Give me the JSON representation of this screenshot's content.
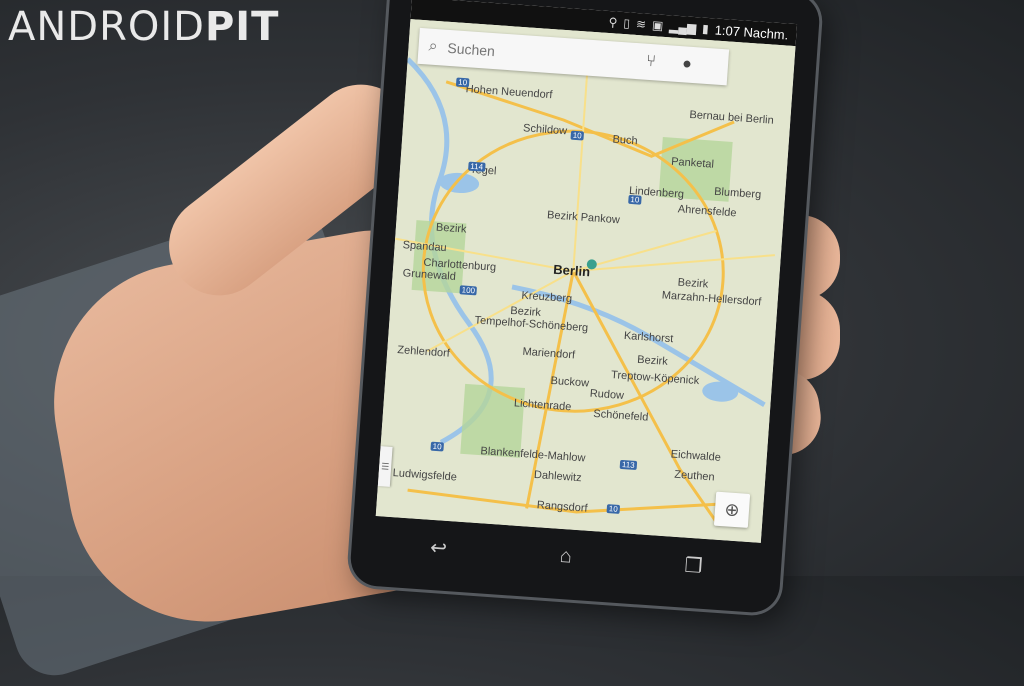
{
  "watermark": {
    "light": "ANDROID",
    "bold": "PIT"
  },
  "statusbar": {
    "time": "1:07 Nachm.",
    "icons": [
      "location-icon",
      "vibrate-icon",
      "wifi-icon",
      "battery-saver-icon",
      "signal-icon",
      "battery-icon"
    ]
  },
  "search": {
    "placeholder": "Suchen",
    "directions_icon": "directions-icon",
    "account_icon": "account-icon"
  },
  "map": {
    "labels": {
      "berlin": "Berlin",
      "pankow": "Bezirk Pankow",
      "marzahn": "Marzahn-Hellersdorf",
      "tempelhof": "Tempelhof-Schöneberg",
      "treptow": "Treptow-Köpenick",
      "kreuzberg": "Kreuzberg",
      "charlottenburg": "Charlottenburg",
      "karlshorst": "Karlshorst",
      "zehlendorf": "Zehlendorf",
      "lichtenrade": "Lichtenrade",
      "blankenfelde": "Blankenfelde-Mahlow",
      "bezirk1": "Bezirk",
      "bezirk2": "Bezirk",
      "bezirk3": "Bezirk",
      "bezirk4": "Bezirk",
      "spandau": "Spandau",
      "mariendorf": "Mariendorf",
      "buckow": "Buckow",
      "rudow": "Rudow",
      "schonefeld": "Schönefeld",
      "eichwalde": "Eichwalde",
      "zeuthen": "Zeuthen",
      "dahlewitz": "Dahlewitz",
      "rangsdorf": "Rangsdorf",
      "ludwigsfelde": "Ludwigsfelde",
      "bernau": "Bernau bei Berlin",
      "ahrensfelde": "Ahrensfelde",
      "buch": "Buch",
      "panketal": "Panketal",
      "hohen": "Hohen Neuendorf",
      "schildow": "Schildow",
      "tegel": "Tegel",
      "gruenewald": "Grunewald",
      "lindenberg": "Lindenberg",
      "blumberg": "Blumberg"
    },
    "shields": [
      "10",
      "10",
      "114",
      "100",
      "10",
      "113",
      "10",
      "10"
    ]
  },
  "nav": {
    "back": "back-icon",
    "home": "home-icon",
    "recents": "recents-icon"
  }
}
